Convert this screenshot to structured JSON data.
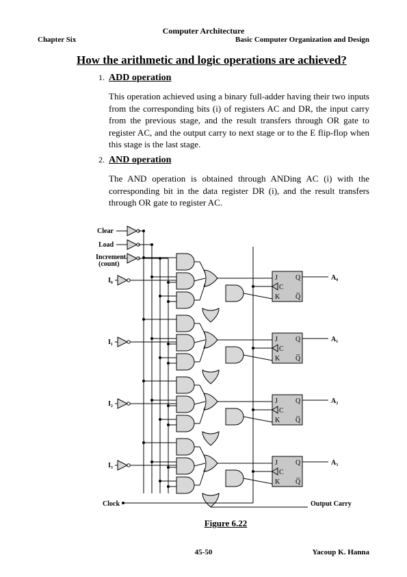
{
  "header": {
    "title": "Computer Architecture",
    "left": "Chapter Six",
    "right": "Basic Computer Organization and Design"
  },
  "main_heading": "How the arithmetic and logic operations are achieved?",
  "sections": [
    {
      "num": "1.",
      "title": "ADD operation",
      "body": "This operation achieved using a binary full-adder having their two inputs from the corresponding bits (i) of registers AC and DR, the input carry from the previous stage, and the result transfers through OR gate to register AC, and the output carry to next stage or to the E flip-flop when this stage is the last stage."
    },
    {
      "num": "2.",
      "title": "AND operation",
      "body": "The AND operation is obtained through ANDing AC (i) with the corresponding bit in the data register DR (i), and the result transfers through OR gate to register AC."
    }
  ],
  "figure": {
    "caption": "Figure 6.22",
    "labels": {
      "clear": "Clear",
      "load": "Load",
      "increment1": "Increment",
      "increment2": "(count)",
      "clock": "Clock",
      "output_carry": "Output Carry",
      "I0": "I₀",
      "I1": "I₁",
      "I2": "I₂",
      "I3": "I₃",
      "A0": "A₀",
      "A1": "A₁",
      "A2": "A₂",
      "A3": "A₃",
      "J": "J",
      "K": "K",
      "C": "C",
      "Q": "Q",
      "Qbar": "Q̅"
    }
  },
  "footer": {
    "page": "45-50",
    "author": "Yacoup K. Hanna"
  }
}
